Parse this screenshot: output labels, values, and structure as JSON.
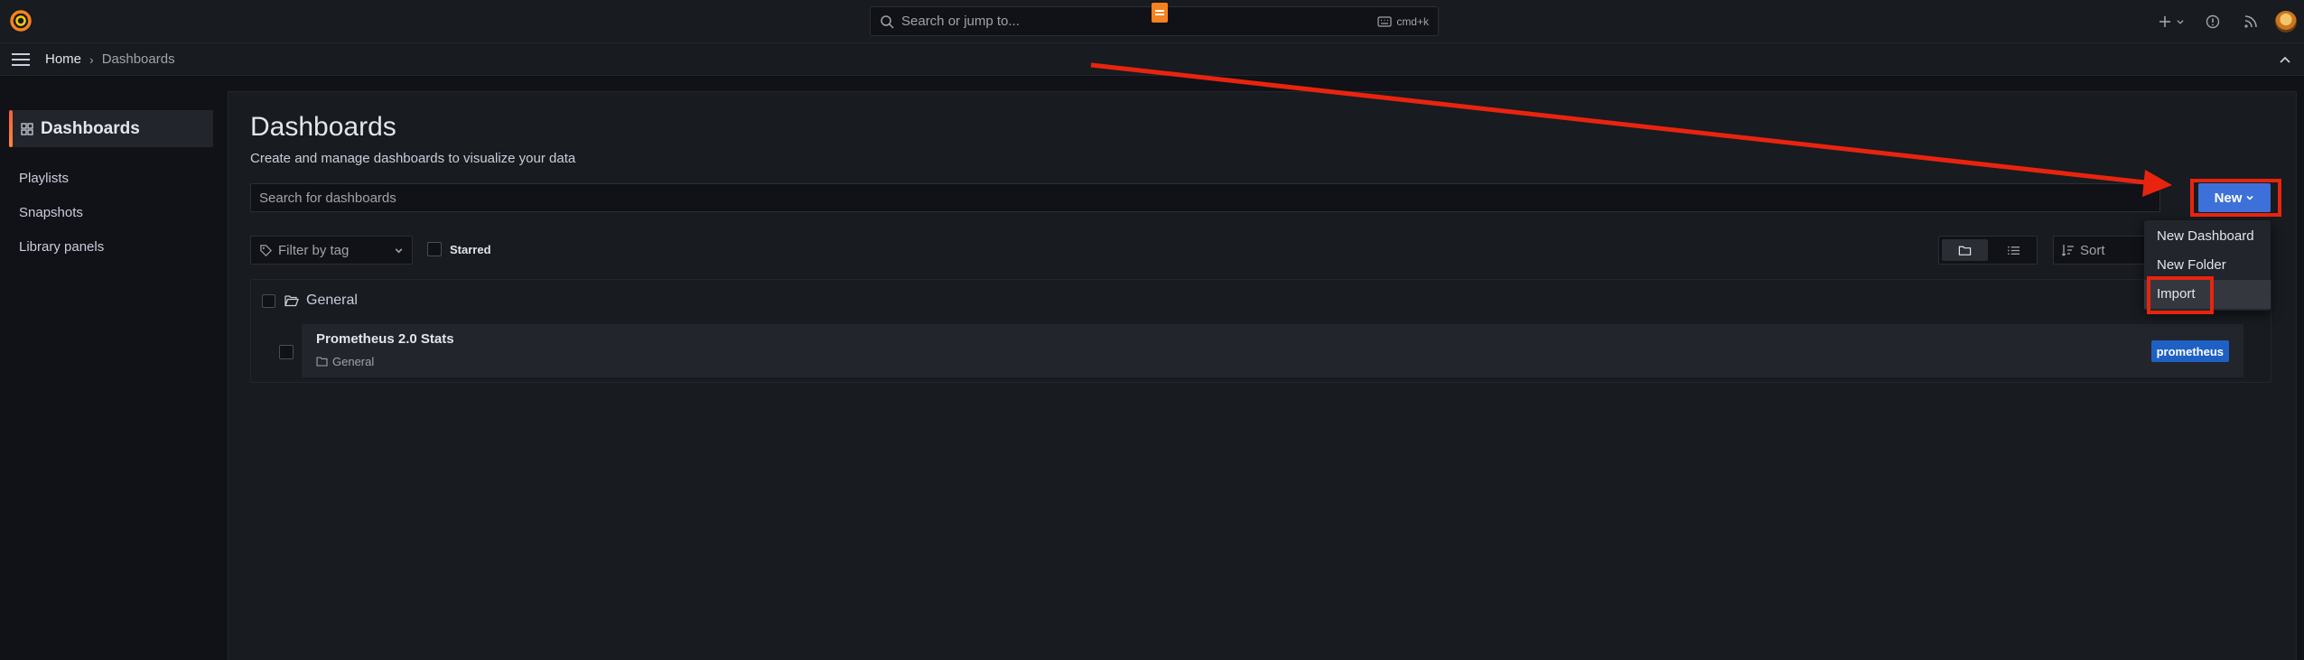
{
  "topbar": {
    "search_placeholder": "Search or jump to...",
    "shortcut": "cmd+k",
    "icons": [
      "grafana-logo-icon",
      "search-icon",
      "keyboard-icon",
      "plus-icon",
      "help-icon",
      "news-icon",
      "avatar"
    ]
  },
  "breadcrumb": {
    "home": "Home",
    "separator": "›",
    "current": "Dashboards"
  },
  "sidebar": {
    "title": "Dashboards",
    "items": [
      {
        "label": "Playlists"
      },
      {
        "label": "Snapshots"
      },
      {
        "label": "Library panels"
      }
    ]
  },
  "main": {
    "title": "Dashboards",
    "subtitle": "Create and manage dashboards to visualize your data",
    "search_placeholder": "Search for dashboards",
    "new_button": "New",
    "filter_by_tag": "Filter by tag",
    "starred_label": "Starred",
    "sort_label": "Sort",
    "folder": {
      "name": "General"
    },
    "dashboard": {
      "title": "Prometheus 2.0 Stats",
      "location": "General",
      "tag": "prometheus"
    }
  },
  "new_menu": {
    "items": [
      {
        "label": "New Dashboard"
      },
      {
        "label": "New Folder"
      },
      {
        "label": "Import"
      }
    ]
  },
  "colors": {
    "background": "#111217",
    "panel": "#181b1f",
    "primary_button": "#3d71d9",
    "tag": "#1f60c4",
    "annotation": "#e8240f",
    "brand": "#f55f3e"
  }
}
